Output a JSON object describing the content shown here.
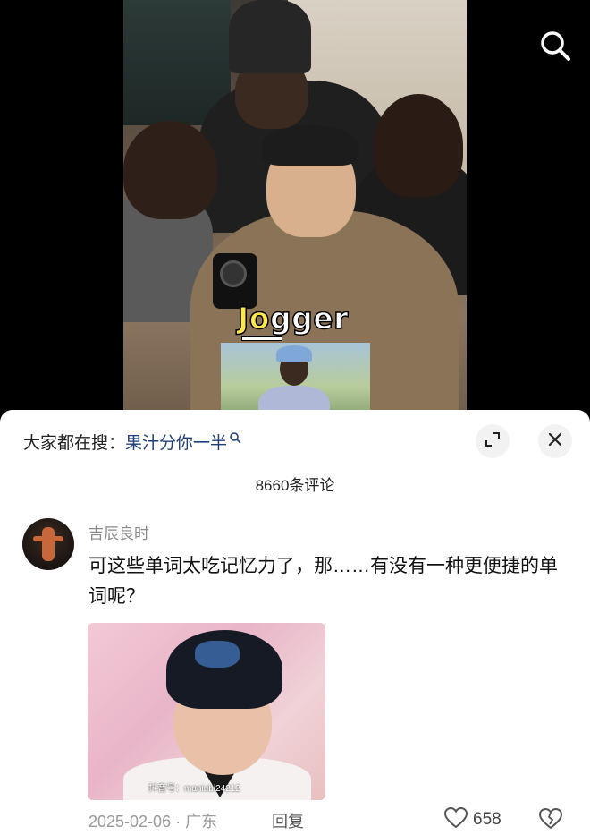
{
  "video": {
    "caption_highlight": "Jo",
    "caption_rest": "gger"
  },
  "top": {
    "search_icon": "search-icon"
  },
  "sheet": {
    "hot_search_prefix": "大家都在搜：",
    "hot_search_term": "果汁分你一半",
    "comment_count": "8660条评论",
    "icons": [
      "expand-icon",
      "close-icon",
      "mini-search-icon"
    ]
  },
  "comment": {
    "username": "吉辰良时",
    "text": "可这些单词太吃记忆力了，那……有没有一种更便捷的单词呢？",
    "image_watermark": "抖音号：maniubi24212",
    "date": "2025-02-06",
    "separator": "·",
    "location": "广东",
    "reply_label": "回复",
    "likes": "658",
    "icons": [
      "heart-icon",
      "broken-heart-icon"
    ]
  },
  "colors": {
    "hot_search_term": "#1f3f7a",
    "caption_highlight": "#ffe94a",
    "meta_text": "#9a9a9a"
  }
}
